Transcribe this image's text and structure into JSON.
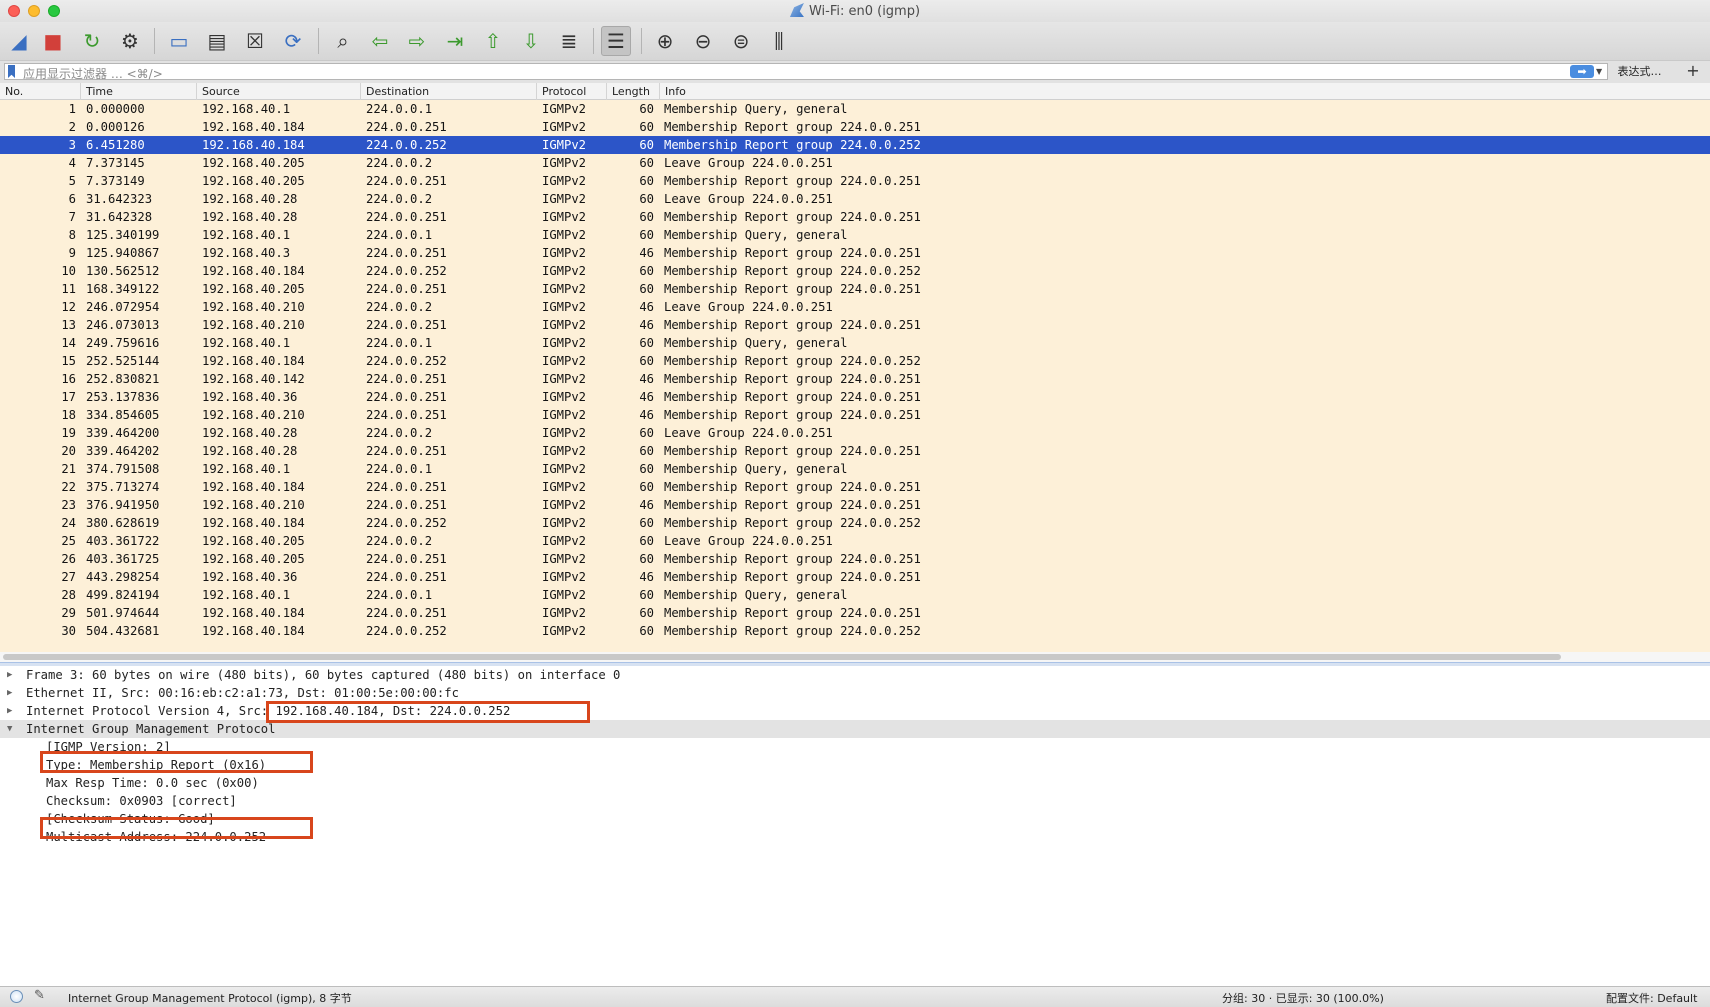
{
  "window": {
    "title": "Wi-Fi: en0 (igmp)"
  },
  "toolbar": {
    "buttons": [
      {
        "name": "start-capture-button",
        "icon": "shark-fin-icon",
        "glyph": "◢"
      },
      {
        "name": "stop-capture-button",
        "icon": "stop-icon",
        "glyph": "■"
      },
      {
        "name": "restart-capture-button",
        "icon": "restart-fin-icon",
        "glyph": "↻"
      },
      {
        "name": "capture-options-button",
        "icon": "gear-icon",
        "glyph": "⚙"
      },
      {
        "name": "open-file-button",
        "icon": "folder-icon",
        "glyph": "▭"
      },
      {
        "name": "save-file-button",
        "icon": "file-icon",
        "glyph": "▤"
      },
      {
        "name": "close-file-button",
        "icon": "close-file-icon",
        "glyph": "☒"
      },
      {
        "name": "reload-file-button",
        "icon": "reload-icon",
        "glyph": "⟳"
      },
      {
        "name": "find-packet-button",
        "icon": "search-icon",
        "glyph": "⌕"
      },
      {
        "name": "go-back-button",
        "icon": "arrow-left-icon",
        "glyph": "⇦"
      },
      {
        "name": "go-forward-button",
        "icon": "arrow-right-icon",
        "glyph": "⇨"
      },
      {
        "name": "go-to-packet-button",
        "icon": "go-to-packet-icon",
        "glyph": "⇥"
      },
      {
        "name": "first-packet-button",
        "icon": "arrow-up-bar-icon",
        "glyph": "⇧"
      },
      {
        "name": "last-packet-button",
        "icon": "arrow-down-bar-icon",
        "glyph": "⇩"
      },
      {
        "name": "auto-scroll-button",
        "icon": "auto-scroll-icon",
        "glyph": "≣"
      },
      {
        "name": "colorize-button",
        "icon": "colorize-lines-icon",
        "glyph": "☰"
      },
      {
        "name": "zoom-in-button",
        "icon": "zoom-in-icon",
        "glyph": "⊕"
      },
      {
        "name": "zoom-out-button",
        "icon": "zoom-out-icon",
        "glyph": "⊖"
      },
      {
        "name": "normal-size-button",
        "icon": "zoom-reset-icon",
        "glyph": "⊜"
      },
      {
        "name": "resize-columns-button",
        "icon": "resize-columns-icon",
        "glyph": "⫼"
      }
    ]
  },
  "filter": {
    "placeholder": "应用显示过滤器 … <⌘/>",
    "apply_glyph": "➡",
    "dropdown_glyph": "▼",
    "expression_label": "表达式…",
    "add_label": "+"
  },
  "packet_list": {
    "columns": [
      "No.",
      "Time",
      "Source",
      "Destination",
      "Protocol",
      "Length",
      "Info"
    ],
    "selected_index": 2,
    "rows": [
      {
        "no": "1",
        "time": "0.000000",
        "src": "192.168.40.1",
        "dst": "224.0.0.1",
        "proto": "IGMPv2",
        "len": "60",
        "info": "Membership Query, general"
      },
      {
        "no": "2",
        "time": "0.000126",
        "src": "192.168.40.184",
        "dst": "224.0.0.251",
        "proto": "IGMPv2",
        "len": "60",
        "info": "Membership Report group 224.0.0.251"
      },
      {
        "no": "3",
        "time": "6.451280",
        "src": "192.168.40.184",
        "dst": "224.0.0.252",
        "proto": "IGMPv2",
        "len": "60",
        "info": "Membership Report group 224.0.0.252"
      },
      {
        "no": "4",
        "time": "7.373145",
        "src": "192.168.40.205",
        "dst": "224.0.0.2",
        "proto": "IGMPv2",
        "len": "60",
        "info": "Leave Group 224.0.0.251"
      },
      {
        "no": "5",
        "time": "7.373149",
        "src": "192.168.40.205",
        "dst": "224.0.0.251",
        "proto": "IGMPv2",
        "len": "60",
        "info": "Membership Report group 224.0.0.251"
      },
      {
        "no": "6",
        "time": "31.642323",
        "src": "192.168.40.28",
        "dst": "224.0.0.2",
        "proto": "IGMPv2",
        "len": "60",
        "info": "Leave Group 224.0.0.251"
      },
      {
        "no": "7",
        "time": "31.642328",
        "src": "192.168.40.28",
        "dst": "224.0.0.251",
        "proto": "IGMPv2",
        "len": "60",
        "info": "Membership Report group 224.0.0.251"
      },
      {
        "no": "8",
        "time": "125.340199",
        "src": "192.168.40.1",
        "dst": "224.0.0.1",
        "proto": "IGMPv2",
        "len": "60",
        "info": "Membership Query, general"
      },
      {
        "no": "9",
        "time": "125.940867",
        "src": "192.168.40.3",
        "dst": "224.0.0.251",
        "proto": "IGMPv2",
        "len": "46",
        "info": "Membership Report group 224.0.0.251"
      },
      {
        "no": "10",
        "time": "130.562512",
        "src": "192.168.40.184",
        "dst": "224.0.0.252",
        "proto": "IGMPv2",
        "len": "60",
        "info": "Membership Report group 224.0.0.252"
      },
      {
        "no": "11",
        "time": "168.349122",
        "src": "192.168.40.205",
        "dst": "224.0.0.251",
        "proto": "IGMPv2",
        "len": "60",
        "info": "Membership Report group 224.0.0.251"
      },
      {
        "no": "12",
        "time": "246.072954",
        "src": "192.168.40.210",
        "dst": "224.0.0.2",
        "proto": "IGMPv2",
        "len": "46",
        "info": "Leave Group 224.0.0.251"
      },
      {
        "no": "13",
        "time": "246.073013",
        "src": "192.168.40.210",
        "dst": "224.0.0.251",
        "proto": "IGMPv2",
        "len": "46",
        "info": "Membership Report group 224.0.0.251"
      },
      {
        "no": "14",
        "time": "249.759616",
        "src": "192.168.40.1",
        "dst": "224.0.0.1",
        "proto": "IGMPv2",
        "len": "60",
        "info": "Membership Query, general"
      },
      {
        "no": "15",
        "time": "252.525144",
        "src": "192.168.40.184",
        "dst": "224.0.0.252",
        "proto": "IGMPv2",
        "len": "60",
        "info": "Membership Report group 224.0.0.252"
      },
      {
        "no": "16",
        "time": "252.830821",
        "src": "192.168.40.142",
        "dst": "224.0.0.251",
        "proto": "IGMPv2",
        "len": "46",
        "info": "Membership Report group 224.0.0.251"
      },
      {
        "no": "17",
        "time": "253.137836",
        "src": "192.168.40.36",
        "dst": "224.0.0.251",
        "proto": "IGMPv2",
        "len": "46",
        "info": "Membership Report group 224.0.0.251"
      },
      {
        "no": "18",
        "time": "334.854605",
        "src": "192.168.40.210",
        "dst": "224.0.0.251",
        "proto": "IGMPv2",
        "len": "46",
        "info": "Membership Report group 224.0.0.251"
      },
      {
        "no": "19",
        "time": "339.464200",
        "src": "192.168.40.28",
        "dst": "224.0.0.2",
        "proto": "IGMPv2",
        "len": "60",
        "info": "Leave Group 224.0.0.251"
      },
      {
        "no": "20",
        "time": "339.464202",
        "src": "192.168.40.28",
        "dst": "224.0.0.251",
        "proto": "IGMPv2",
        "len": "60",
        "info": "Membership Report group 224.0.0.251"
      },
      {
        "no": "21",
        "time": "374.791508",
        "src": "192.168.40.1",
        "dst": "224.0.0.1",
        "proto": "IGMPv2",
        "len": "60",
        "info": "Membership Query, general"
      },
      {
        "no": "22",
        "time": "375.713274",
        "src": "192.168.40.184",
        "dst": "224.0.0.251",
        "proto": "IGMPv2",
        "len": "60",
        "info": "Membership Report group 224.0.0.251"
      },
      {
        "no": "23",
        "time": "376.941950",
        "src": "192.168.40.210",
        "dst": "224.0.0.251",
        "proto": "IGMPv2",
        "len": "46",
        "info": "Membership Report group 224.0.0.251"
      },
      {
        "no": "24",
        "time": "380.628619",
        "src": "192.168.40.184",
        "dst": "224.0.0.252",
        "proto": "IGMPv2",
        "len": "60",
        "info": "Membership Report group 224.0.0.252"
      },
      {
        "no": "25",
        "time": "403.361722",
        "src": "192.168.40.205",
        "dst": "224.0.0.2",
        "proto": "IGMPv2",
        "len": "60",
        "info": "Leave Group 224.0.0.251"
      },
      {
        "no": "26",
        "time": "403.361725",
        "src": "192.168.40.205",
        "dst": "224.0.0.251",
        "proto": "IGMPv2",
        "len": "60",
        "info": "Membership Report group 224.0.0.251"
      },
      {
        "no": "27",
        "time": "443.298254",
        "src": "192.168.40.36",
        "dst": "224.0.0.251",
        "proto": "IGMPv2",
        "len": "46",
        "info": "Membership Report group 224.0.0.251"
      },
      {
        "no": "28",
        "time": "499.824194",
        "src": "192.168.40.1",
        "dst": "224.0.0.1",
        "proto": "IGMPv2",
        "len": "60",
        "info": "Membership Query, general"
      },
      {
        "no": "29",
        "time": "501.974644",
        "src": "192.168.40.184",
        "dst": "224.0.0.251",
        "proto": "IGMPv2",
        "len": "60",
        "info": "Membership Report group 224.0.0.251"
      },
      {
        "no": "30",
        "time": "504.432681",
        "src": "192.168.40.184",
        "dst": "224.0.0.252",
        "proto": "IGMPv2",
        "len": "60",
        "info": "Membership Report group 224.0.0.252"
      }
    ]
  },
  "details": {
    "frame": "Frame 3: 60 bytes on wire (480 bits), 60 bytes captured (480 bits) on interface 0",
    "ethernet": "Ethernet II, Src: 00:16:eb:c2:a1:73, Dst: 01:00:5e:00:00:fc",
    "ip_prefix": "Internet Protocol Version 4, ",
    "ip_addrs": "Src: 192.168.40.184, Dst: 224.0.0.252",
    "igmp": "Internet Group Management Protocol",
    "igmp_fields": [
      "[IGMP Version: 2]",
      "Type: Membership Report (0x16)",
      "Max Resp Time: 0.0 sec (0x00)",
      "Checksum: 0x0903 [correct]",
      "[Checksum Status: Good]",
      "Multicast Address: 224.0.0.252"
    ],
    "collapsed_glyph": "▶",
    "expanded_glyph": "▼"
  },
  "status": {
    "selected_field": "Internet Group Management Protocol (igmp), 8 字节",
    "packets": "分组: 30 · 已显示: 30 (100.0%)",
    "profile": "配置文件: Default"
  },
  "colors": {
    "row_background": "#fdf0d8",
    "selected_row": "#2c55c8",
    "highlight_box": "#d8461c"
  }
}
